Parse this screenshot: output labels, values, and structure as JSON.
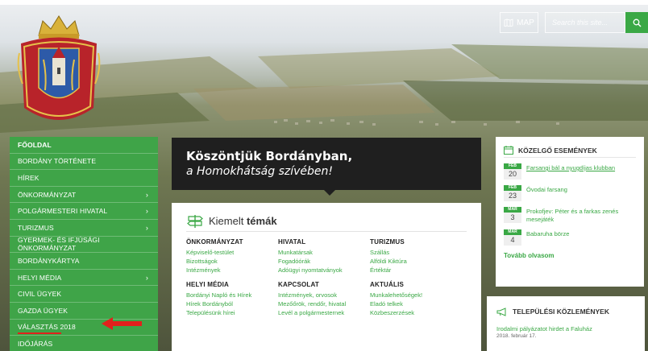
{
  "header": {
    "map_label": "MAP",
    "search_placeholder": "Search this site..."
  },
  "sidebar": {
    "items": [
      {
        "label": "FŐOLDAL",
        "has_sub": false
      },
      {
        "label": "BORDÁNY TÖRTÉNETE",
        "has_sub": false
      },
      {
        "label": "HÍREK",
        "has_sub": false
      },
      {
        "label": "ÖNKORMÁNYZAT",
        "has_sub": true
      },
      {
        "label": "POLGÁRMESTERI HIVATAL",
        "has_sub": true
      },
      {
        "label": "TURIZMUS",
        "has_sub": true
      },
      {
        "label": "GYERMEK- ÉS IFJÚSÁGI ÖNKORMÁNYZAT",
        "has_sub": false
      },
      {
        "label": "BORDÁNYKÁRTYA",
        "has_sub": false
      },
      {
        "label": "HELYI MÉDIA",
        "has_sub": true
      },
      {
        "label": "CIVIL ÜGYEK",
        "has_sub": false
      },
      {
        "label": "GAZDA ÜGYEK",
        "has_sub": false
      },
      {
        "label": "VÁLASZTÁS 2018",
        "has_sub": false
      },
      {
        "label": "IDŐJÁRÁS",
        "has_sub": false
      }
    ]
  },
  "welcome": {
    "line1": "Köszöntjük Bordányban,",
    "line2": "a Homokhátság szívében!"
  },
  "topics": {
    "title_plain": "Kiemelt ",
    "title_bold": "témák",
    "columns": [
      {
        "title": "ÖNKORMÁNYZAT",
        "links": [
          "Képviselő-testület",
          "Bizottságok",
          "Intézmények"
        ]
      },
      {
        "title": "HIVATAL",
        "links": [
          "Munkatársak",
          "Fogadóórák",
          "Adóügyi nyomtatványok"
        ]
      },
      {
        "title": "TURIZMUS",
        "links": [
          "Szállás",
          "Alföldi Kiktúra",
          "Értéktár"
        ]
      },
      {
        "title": "HELYI MÉDIA",
        "links": [
          "Bordányi Napló és Hírek",
          "Hírek Bordányból",
          "Településünk hírei"
        ]
      },
      {
        "title": "KAPCSOLAT",
        "links": [
          "Intézmények, orvosok",
          "Mezőőrök, rendőr, hivatal",
          "Levél a polgármesternek"
        ]
      },
      {
        "title": "AKTUÁLIS",
        "links": [
          "Munkalehetőségek!",
          "Eladó telkek",
          "Közbeszerzések"
        ]
      }
    ]
  },
  "events": {
    "title": "KÖZELGŐ ESEMÉNYEK",
    "items": [
      {
        "month": "FEB",
        "day": "20",
        "title": "Farsangi bál a nyugdíjas klubban"
      },
      {
        "month": "FEB",
        "day": "23",
        "title": "Óvodai farsang"
      },
      {
        "month": "MÁR",
        "day": "3",
        "title": "Prokofjev: Péter és a farkas zenés mesejáték"
      },
      {
        "month": "MÁR",
        "day": "4",
        "title": "Babaruha börze"
      }
    ],
    "more": "Tovább olvasom"
  },
  "notices": {
    "title": "TELEPÜLÉSI KÖZLEMÉNYEK",
    "item_title": "Irodalmi pályázatot hirdet a Faluház",
    "item_date": "2018. február 17."
  },
  "colors": {
    "accent": "#3aa845",
    "nav_bg": "#3fa448",
    "banner": "#1f1f1f",
    "highlight": "#e2211c"
  }
}
